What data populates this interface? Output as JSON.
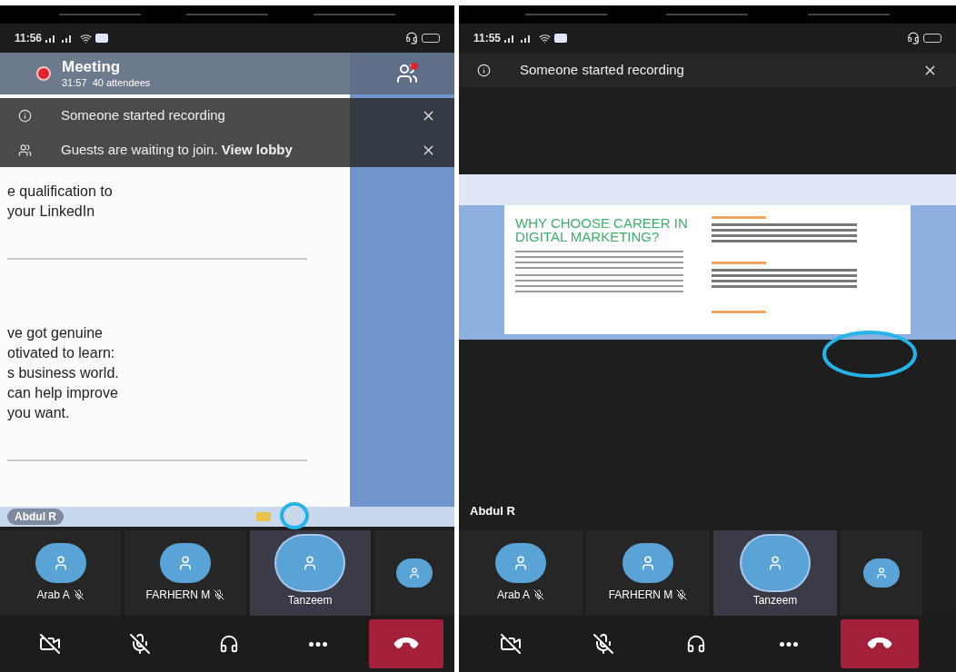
{
  "phones": [
    {
      "status_bar": {
        "time": "11:56"
      },
      "meeting_header": {
        "title": "Meeting",
        "subtitle": "31:57  40 attendees",
        "recording": true,
        "lobby_alert": true
      },
      "banners": [
        {
          "kind": "recording",
          "text": "Someone started recording"
        },
        {
          "kind": "lobby",
          "text": "Guests are waiting to join.",
          "link": "View lobby"
        }
      ],
      "shared_screen": {
        "kind": "document",
        "lines_top": [
          "e qualification to",
          "your LinkedIn"
        ],
        "lines_bottom": [
          "ve got genuine",
          "otivated to learn:",
          "s business world.",
          "can help improve",
          "you want."
        ]
      },
      "presenter": "Abdul R",
      "participants": [
        {
          "name": "Arab A",
          "muted": true,
          "selected": false
        },
        {
          "name": "FARHERN M",
          "muted": true,
          "selected": false
        },
        {
          "name": "Tanzeem",
          "muted": false,
          "selected": true
        },
        {
          "muted": false,
          "selected": false
        }
      ],
      "controls": [
        {
          "kind": "camera"
        },
        {
          "kind": "mic"
        },
        {
          "kind": "audio"
        },
        {
          "kind": "more"
        },
        {
          "kind": "hangup"
        }
      ]
    },
    {
      "status_bar": {
        "time": "11:55"
      },
      "banners": [
        {
          "kind": "recording",
          "text": "Someone started recording"
        }
      ],
      "shared_screen": {
        "kind": "slide",
        "heading": "WHY CHOOSE CAREER IN DIGITAL MARKETING?"
      },
      "presenter": "Abdul R",
      "participants": [
        {
          "name": "Arab A",
          "muted": true,
          "selected": false
        },
        {
          "name": "FARHERN M",
          "muted": true,
          "selected": false
        },
        {
          "name": "Tanzeem",
          "muted": false,
          "selected": true
        },
        {
          "muted": false,
          "selected": false
        }
      ],
      "controls": [
        {
          "kind": "camera"
        },
        {
          "kind": "mic"
        },
        {
          "kind": "audio"
        },
        {
          "kind": "more"
        },
        {
          "kind": "hangup"
        }
      ]
    }
  ]
}
